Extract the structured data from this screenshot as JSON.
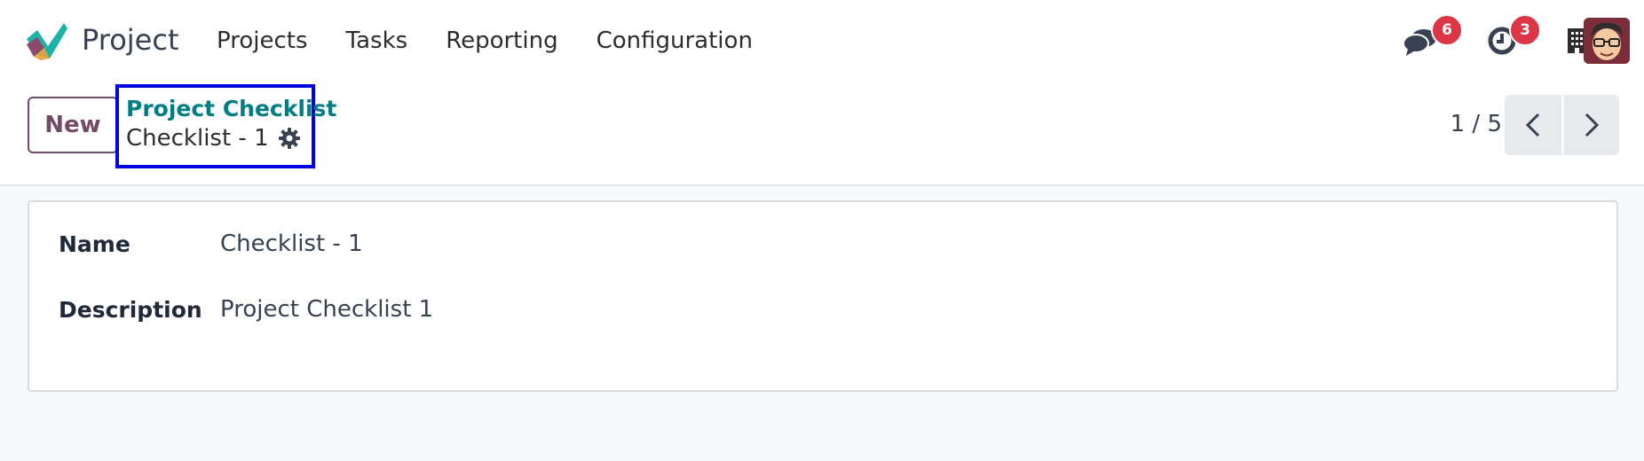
{
  "app": {
    "name": "Project"
  },
  "menu": [
    {
      "label": "Projects"
    },
    {
      "label": "Tasks"
    },
    {
      "label": "Reporting"
    },
    {
      "label": "Configuration"
    }
  ],
  "systray": {
    "messages_count": "6",
    "activities_count": "3"
  },
  "control": {
    "new_label": "New",
    "breadcrumb_parent": "Project Checklist",
    "breadcrumb_current": "Checklist - 1",
    "pager_value": "1 / 5"
  },
  "form": {
    "fields": [
      {
        "label": "Name",
        "value": "Checklist - 1"
      },
      {
        "label": "Description",
        "value": "Project Checklist 1"
      }
    ]
  },
  "colors": {
    "brand": "#714b67",
    "link": "#017e84",
    "badge": "#dc3545",
    "highlight_box": "#0000e0"
  }
}
